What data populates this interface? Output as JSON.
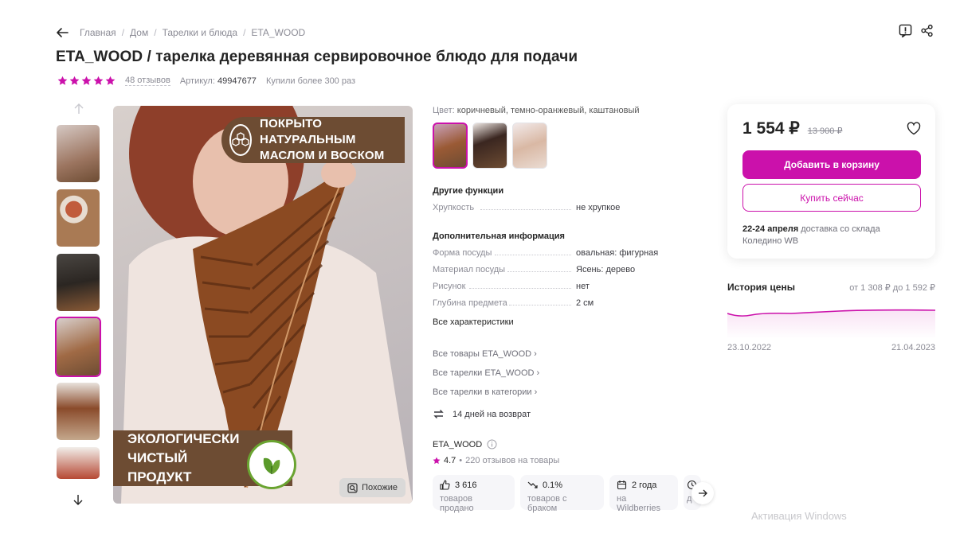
{
  "breadcrumbs": [
    "Главная",
    "Дом",
    "Тарелки и блюда",
    "ETA_WOOD"
  ],
  "title": "ETA_WOOD / тарелка деревянная сервировочное блюдо для подачи",
  "rating": {
    "stars": 5,
    "reviews": "48 отзывов"
  },
  "article": {
    "label": "Артикул:",
    "value": "49947677"
  },
  "bought": "Купили более 300 раз",
  "main_image": {
    "badge_top": "Покрыто натуральным маслом и воском",
    "badge_bottom": "Экологически чистый продукт",
    "similar_button": "Похожие"
  },
  "color": {
    "label": "Цвет:",
    "value": "коричневый, темно-оранжевый, каштановый"
  },
  "other_functions": {
    "heading": "Другие функции",
    "rows": [
      {
        "key": "Хрупкость",
        "value": "не хрупкое"
      }
    ]
  },
  "additional_info": {
    "heading": "Дополнительная информация",
    "rows": [
      {
        "key": "Форма посуды",
        "value": "овальная: фигурная"
      },
      {
        "key": "Материал посуды",
        "value": "Ясень: дерево"
      },
      {
        "key": "Рисунок",
        "value": "нет"
      },
      {
        "key": "Глубина предмета",
        "value": "2 см"
      }
    ],
    "all_link": "Все характеристики"
  },
  "links": [
    "Все товары ETA_WOOD",
    "Все тарелки ETA_WOOD",
    "Все тарелки в категории"
  ],
  "return_policy": "14 дней на возврат",
  "seller": {
    "name": "ETA_WOOD",
    "rating": "4.7",
    "reviews": "220 отзывов на товары"
  },
  "stats": [
    {
      "value": "3 616",
      "label": "товаров продано",
      "icon": "thumbs-up-icon"
    },
    {
      "value": "0.1%",
      "label": "товаров с браком",
      "icon": "trend-down-icon"
    },
    {
      "value": "2 года",
      "label": "на Wildberries",
      "icon": "calendar-icon"
    },
    {
      "value": "",
      "label": "д",
      "icon": "clock-icon"
    }
  ],
  "buybox": {
    "price": "1 554 ₽",
    "old_price": "13 900 ₽",
    "add_to_cart": "Добавить в корзину",
    "buy_now": "Купить сейчас",
    "delivery_date": "22-24 апреля",
    "delivery_text": "доставка со склада",
    "warehouse": "Коледино WB"
  },
  "price_history": {
    "title": "История цены",
    "range": "от 1 308 ₽ до 1 592 ₽",
    "start_date": "23.10.2022",
    "end_date": "21.04.2023"
  },
  "watermark": "Активация Windows",
  "colors": {
    "accent": "#cb11ab",
    "brown": "#6d4c33",
    "green": "#6aa431"
  }
}
